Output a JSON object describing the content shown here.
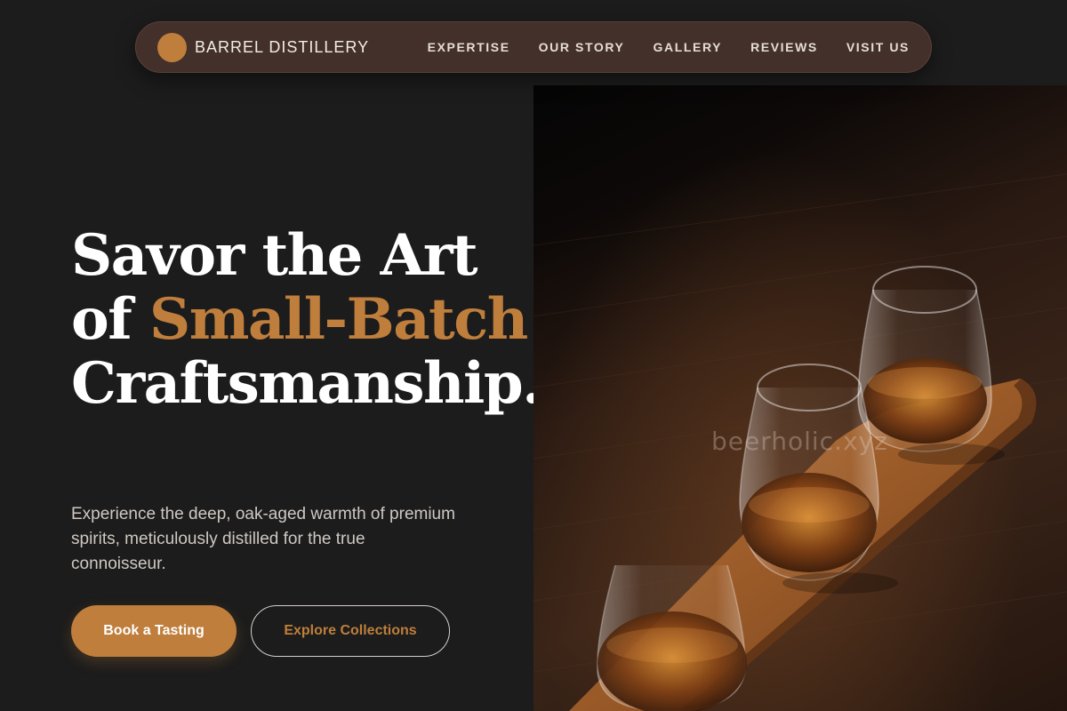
{
  "brand": {
    "name": "BARREL DISTILLERY"
  },
  "nav": {
    "items": [
      {
        "label": "EXPERTISE"
      },
      {
        "label": "OUR STORY"
      },
      {
        "label": "GALLERY"
      },
      {
        "label": "REVIEWS"
      },
      {
        "label": "VISIT US"
      }
    ]
  },
  "hero": {
    "title_line1": "Savor the Art",
    "title_of": "of ",
    "title_accent": "Small-Batch",
    "title_last": "Craftsmanship.",
    "subtitle": "Experience the deep, oak-aged warmth of premium spirits, meticulously distilled for the true connoisseur.",
    "primary_button": "Book a Tasting",
    "secondary_button": "Explore Collections",
    "image_watermark": "beerholic.xyz"
  },
  "colors": {
    "accent": "#bf7e3c",
    "nav_bg": "#43302b",
    "page_bg": "#1c1c1c"
  }
}
